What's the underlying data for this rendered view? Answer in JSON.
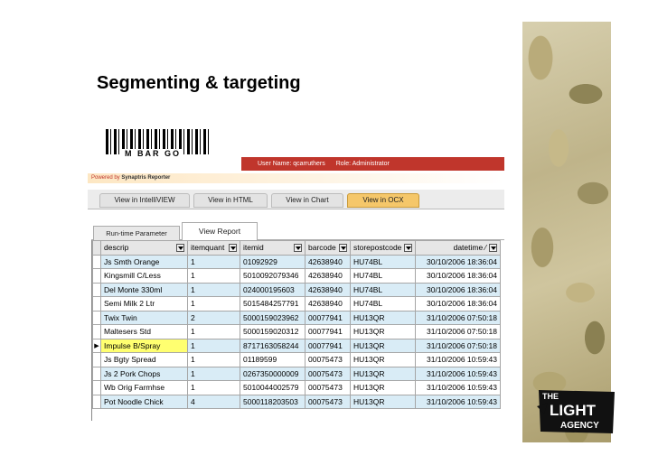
{
  "slide": {
    "title": "Segmenting & targeting"
  },
  "app": {
    "logo_text": "M BAR GO",
    "user_bar": {
      "user": "User Name: qcarruthers",
      "role": "Role: Administrator"
    },
    "powered_by": {
      "prefix": "Powered by",
      "product": "Synaptris Reporter"
    },
    "view_tabs": [
      {
        "label": "View in IntelliVIEW",
        "active": false
      },
      {
        "label": "View in HTML",
        "active": false
      },
      {
        "label": "View in Chart",
        "active": false
      },
      {
        "label": "View in OCX",
        "active": true
      }
    ],
    "sub_tabs": [
      {
        "label": "Run-time Parameter",
        "active": false
      },
      {
        "label": "View Report",
        "active": true
      }
    ],
    "grid": {
      "columns": [
        "descrip",
        "itemquant",
        "itemid",
        "barcode",
        "storepostcode",
        "datetime"
      ],
      "sorted_column": "datetime",
      "sort_indicator": "⁄",
      "current_row_marker": "▶",
      "rows": [
        [
          "Js Smth Orange",
          "1",
          "01092929",
          "42638940",
          "HU74BL",
          "30/10/2006 18:36:04"
        ],
        [
          "Kingsmill C/Less",
          "1",
          "5010092079346",
          "42638940",
          "HU74BL",
          "30/10/2006 18:36:04"
        ],
        [
          "Del Monte 330ml",
          "1",
          "024000195603",
          "42638940",
          "HU74BL",
          "30/10/2006 18:36:04"
        ],
        [
          "Semi Milk 2 Ltr",
          "1",
          "5015484257791",
          "42638940",
          "HU74BL",
          "30/10/2006 18:36:04"
        ],
        [
          "Twix Twin",
          "2",
          "5000159023962",
          "00077941",
          "HU13QR",
          "31/10/2006 07:50:18"
        ],
        [
          "Maltesers Std",
          "1",
          "5000159020312",
          "00077941",
          "HU13QR",
          "31/10/2006 07:50:18"
        ],
        [
          "Impulse B/Spray",
          "1",
          "8717163058244",
          "00077941",
          "HU13QR",
          "31/10/2006 07:50:18"
        ],
        [
          "Js Bgty Spread",
          "1",
          "01189599",
          "00075473",
          "HU13QR",
          "31/10/2006 10:59:43"
        ],
        [
          "Js 2 Pork Chops",
          "1",
          "0267350000009",
          "00075473",
          "HU13QR",
          "31/10/2006 10:59:43"
        ],
        [
          "Wb Orig Farmhse",
          "1",
          "5010044002579",
          "00075473",
          "HU13QR",
          "31/10/2006 10:59:43"
        ],
        [
          "Pot Noodle Chick",
          "4",
          "5000118203503",
          "00075473",
          "HU13QR",
          "31/10/2006 10:59:43"
        ]
      ],
      "selected_row_index": 6
    }
  },
  "brand": {
    "line1": "THE",
    "line2": "LIGHT",
    "line3": "AGENCY"
  },
  "colors": {
    "header_red": "#c0362c",
    "active_tab": "#f5c76a",
    "alt_row": "#d9ecf6",
    "highlight": "#ffff70"
  }
}
